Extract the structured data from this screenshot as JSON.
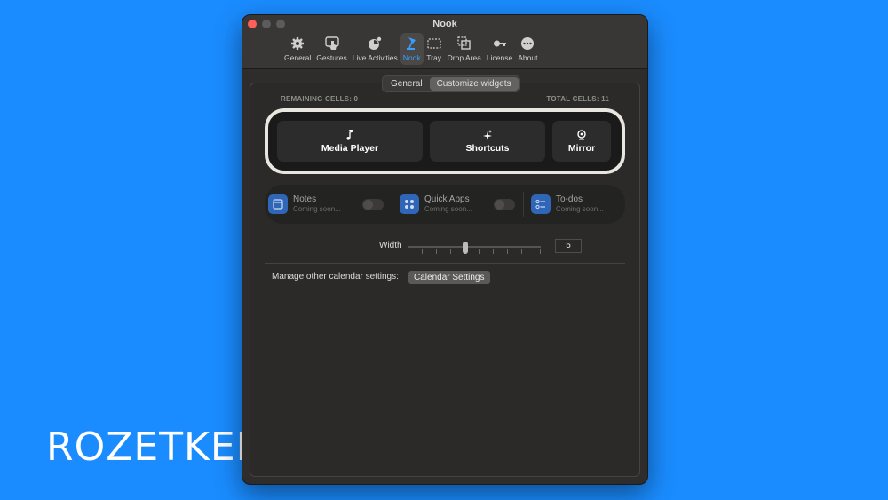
{
  "window": {
    "title": "Nook"
  },
  "toolbar": [
    {
      "label": "General",
      "icon": "gear-icon"
    },
    {
      "label": "Gestures",
      "icon": "gesture-hand-icon"
    },
    {
      "label": "Live Activities",
      "icon": "live-activities-icon"
    },
    {
      "label": "Nook",
      "icon": "nook-lamp-icon"
    },
    {
      "label": "Tray",
      "icon": "tray-icon"
    },
    {
      "label": "Drop Area",
      "icon": "drop-area-icon"
    },
    {
      "label": "License",
      "icon": "key-icon"
    },
    {
      "label": "About",
      "icon": "ellipsis-icon"
    }
  ],
  "tabs": {
    "general": "General",
    "customize": "Customize widgets"
  },
  "cells": {
    "remaining": "REMAINING CELLS: 0",
    "total": "TOTAL CELLS: 11"
  },
  "widgets": [
    {
      "label": "Media Player",
      "icon": "music-note-icon"
    },
    {
      "label": "Shortcuts",
      "icon": "sparkles-icon"
    },
    {
      "label": "Mirror",
      "icon": "webcam-icon"
    }
  ],
  "coming_soon": [
    {
      "label": "Notes",
      "sub": "Coming soon...",
      "icon": "notes-icon"
    },
    {
      "label": "Quick Apps",
      "sub": "Coming soon...",
      "icon": "grid-icon"
    },
    {
      "label": "To-dos",
      "sub": "Coming soon...",
      "icon": "checklist-icon"
    }
  ],
  "width": {
    "label": "Width",
    "value": "5"
  },
  "calendar": {
    "label": "Manage other calendar settings:",
    "button": "Calendar Settings"
  },
  "watermark": "ROZETKED",
  "colors": {
    "background": "#1a8cff",
    "accent": "#3a9dff",
    "window": "#2e2d2c"
  }
}
